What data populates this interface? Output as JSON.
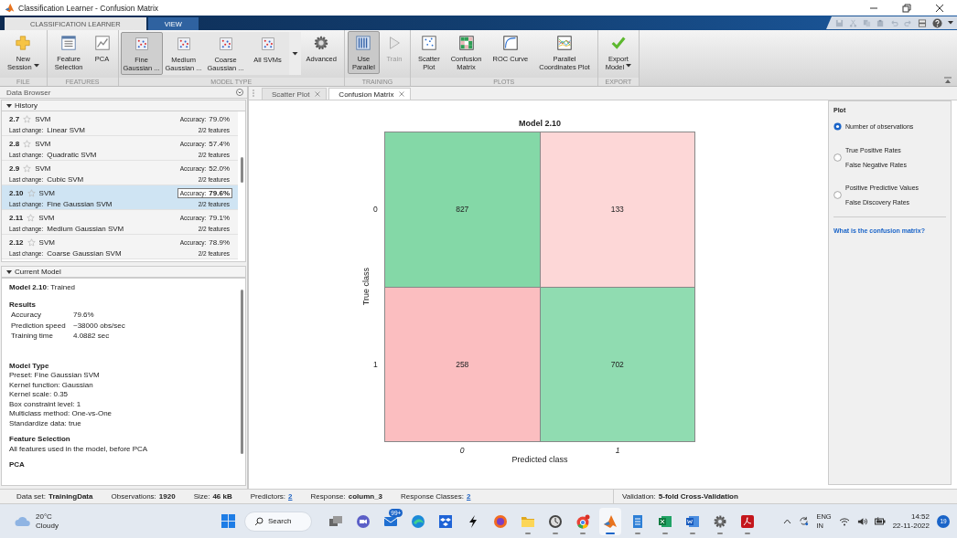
{
  "window": {
    "title": "Classification Learner - Confusion Matrix"
  },
  "ribbon_tabs": [
    {
      "label": "CLASSIFICATION LEARNER",
      "selected": true
    },
    {
      "label": "VIEW",
      "selected": false
    }
  ],
  "toolstrip": [
    {
      "label": "FILE",
      "buttons": [
        {
          "kind": "plus",
          "label": "New\nSession",
          "dropdown": true,
          "pressed": false,
          "disabled": false
        }
      ]
    },
    {
      "label": "FEATURES",
      "buttons": [
        {
          "kind": "list",
          "label": "Feature\nSelection",
          "dropdown": false,
          "pressed": false,
          "disabled": false
        },
        {
          "kind": "pca",
          "label": "PCA",
          "dropdown": false,
          "pressed": false,
          "disabled": false
        }
      ]
    },
    {
      "label": "MODEL TYPE",
      "gallery": [
        {
          "label": "Fine\nGaussian ...",
          "selected": true
        },
        {
          "label": "Medium\nGaussian ...",
          "selected": false
        },
        {
          "label": "Coarse\nGaussian ...",
          "selected": false
        },
        {
          "label": "All SVMs",
          "selected": false
        }
      ],
      "buttons": [
        {
          "kind": "gear",
          "label": "Advanced",
          "dropdown": false,
          "pressed": false,
          "disabled": false
        }
      ]
    },
    {
      "label": "TRAINING",
      "buttons": [
        {
          "kind": "parallel",
          "label": "Use\nParallel",
          "dropdown": false,
          "pressed": true,
          "disabled": false
        },
        {
          "kind": "play",
          "label": "Train",
          "dropdown": false,
          "pressed": false,
          "disabled": true
        }
      ]
    },
    {
      "label": "PLOTS",
      "buttons": [
        {
          "kind": "scatter",
          "label": "Scatter\nPlot",
          "dropdown": false,
          "pressed": false,
          "disabled": false
        },
        {
          "kind": "grid",
          "label": "Confusion\nMatrix",
          "dropdown": false,
          "pressed": false,
          "disabled": false
        },
        {
          "kind": "roc",
          "label": "ROC Curve",
          "dropdown": false,
          "pressed": false,
          "disabled": false
        },
        {
          "kind": "coords",
          "label": "Parallel\nCoordinates Plot",
          "dropdown": false,
          "pressed": false,
          "disabled": false
        }
      ]
    },
    {
      "label": "EXPORT",
      "buttons": [
        {
          "kind": "check",
          "label": "Export\nModel",
          "dropdown": true,
          "pressed": false,
          "disabled": false
        }
      ]
    }
  ],
  "data_browser": {
    "title": "Data Browser"
  },
  "history": {
    "title": "History",
    "items": [
      {
        "number": "2.7",
        "type": "SVM",
        "last_change_label": "Last change:",
        "last_change": "Linear SVM",
        "accuracy_label": "Accuracy:",
        "accuracy": "79.0%",
        "features": "2/2 features",
        "selected": false
      },
      {
        "number": "2.8",
        "type": "SVM",
        "last_change_label": "Last change:",
        "last_change": "Quadratic SVM",
        "accuracy_label": "Accuracy:",
        "accuracy": "57.4%",
        "features": "2/2 features",
        "selected": false
      },
      {
        "number": "2.9",
        "type": "SVM",
        "last_change_label": "Last change:",
        "last_change": "Cubic SVM",
        "accuracy_label": "Accuracy:",
        "accuracy": "52.0%",
        "features": "2/2 features",
        "selected": false
      },
      {
        "number": "2.10",
        "type": "SVM",
        "last_change_label": "Last change:",
        "last_change": "Fine Gaussian SVM",
        "accuracy_label": "Accuracy:",
        "accuracy": "79.6%",
        "features": "2/2 features",
        "selected": true
      },
      {
        "number": "2.11",
        "type": "SVM",
        "last_change_label": "Last change:",
        "last_change": "Medium Gaussian SVM",
        "accuracy_label": "Accuracy:",
        "accuracy": "79.1%",
        "features": "2/2 features",
        "selected": false
      },
      {
        "number": "2.12",
        "type": "SVM",
        "last_change_label": "Last change:",
        "last_change": "Coarse Gaussian SVM",
        "accuracy_label": "Accuracy:",
        "accuracy": "78.9%",
        "features": "2/2 features",
        "selected": false
      }
    ]
  },
  "current_model": {
    "title": "Current Model",
    "status": "**Model 2.10**: Trained",
    "sections": [
      {
        "heading": "Results",
        "rows": [
          {
            "label": "Accuracy",
            "value": "79.6%"
          },
          {
            "label": "Prediction speed",
            "value": "~38000 obs/sec"
          },
          {
            "label": "Training time",
            "value": "4.0882 sec"
          }
        ]
      },
      {
        "heading": "Model Type",
        "lines": [
          "Preset: Fine Gaussian SVM",
          "Kernel function: Gaussian",
          "Kernel scale: 0.35",
          "Box constraint level: 1",
          "Multiclass method: One-vs-One",
          "Standardize data: true"
        ]
      },
      {
        "heading": "Feature Selection",
        "lines": [
          "All features used in the model, before PCA"
        ]
      },
      {
        "heading": "PCA"
      }
    ]
  },
  "document_tabs": [
    {
      "label": "Scatter Plot",
      "selected": false
    },
    {
      "label": "Confusion Matrix",
      "selected": true
    }
  ],
  "confusion_matrix": {
    "title": "Model 2.10",
    "ylabel": "True class",
    "xlabel": "Predicted class",
    "row_labels": [
      "0",
      "1"
    ],
    "column_labels": [
      "0",
      "1"
    ],
    "cells": [
      [
        {
          "value": "827",
          "color": "#84d8a7"
        },
        {
          "value": "133",
          "color": "#fdd7d7"
        }
      ],
      [
        {
          "value": "258",
          "color": "#fbbec0"
        },
        {
          "value": "702",
          "color": "#90dcb1"
        }
      ]
    ]
  },
  "plot_options": {
    "title": "Plot",
    "options": [
      {
        "lines": [
          "Number of observations"
        ],
        "selected": true
      },
      {
        "lines": [
          "True Positive Rates",
          "False Negative Rates"
        ],
        "selected": false
      },
      {
        "lines": [
          "Positive Predictive Values",
          "False Discovery Rates"
        ],
        "selected": false
      }
    ],
    "help_link": "What is the confusion matrix?"
  },
  "status_bar": {
    "items": [
      {
        "label": "Data set:",
        "value": "TrainingData",
        "link": false
      },
      {
        "label": "Observations:",
        "value": "1920",
        "link": false
      },
      {
        "label": "Size:",
        "value": "46 kB",
        "link": false
      },
      {
        "label": "Predictors:",
        "value": "2",
        "link": true
      },
      {
        "label": "Response:",
        "value": "column_3",
        "link": false
      },
      {
        "label": "Response Classes:",
        "value": "2",
        "link": true
      }
    ],
    "validation": {
      "label": "Validation:",
      "value": "5-fold Cross-Validation"
    }
  },
  "taskbar": {
    "weather": {
      "temperature": "20°C",
      "condition": "Cloudy"
    },
    "search": "Search",
    "apps": [
      {
        "kind": "taskview",
        "running": false,
        "active": false
      },
      {
        "kind": "camera",
        "running": false,
        "active": false
      },
      {
        "kind": "mail",
        "running": false,
        "active": false,
        "badge": "99+"
      },
      {
        "kind": "edge",
        "running": false,
        "active": false
      },
      {
        "kind": "dropbox",
        "running": false,
        "active": false
      },
      {
        "kind": "bolt",
        "running": false,
        "active": false
      },
      {
        "kind": "firefox",
        "running": false,
        "active": false
      },
      {
        "kind": "folder",
        "running": true,
        "active": false
      },
      {
        "kind": "clock",
        "running": true,
        "active": false
      },
      {
        "kind": "chrome",
        "running": true,
        "active": false
      },
      {
        "kind": "matlab",
        "running": true,
        "active": true
      },
      {
        "kind": "notepad",
        "running": true,
        "active": false
      },
      {
        "kind": "excel",
        "running": true,
        "active": false
      },
      {
        "kind": "word",
        "running": true,
        "active": false
      },
      {
        "kind": "settings",
        "running": true,
        "active": false
      },
      {
        "kind": "acrobat",
        "running": true,
        "active": false
      }
    ],
    "language": "ENG",
    "region": "IN",
    "time": "14:52",
    "date": "22-11-2022",
    "notifications": "19"
  }
}
